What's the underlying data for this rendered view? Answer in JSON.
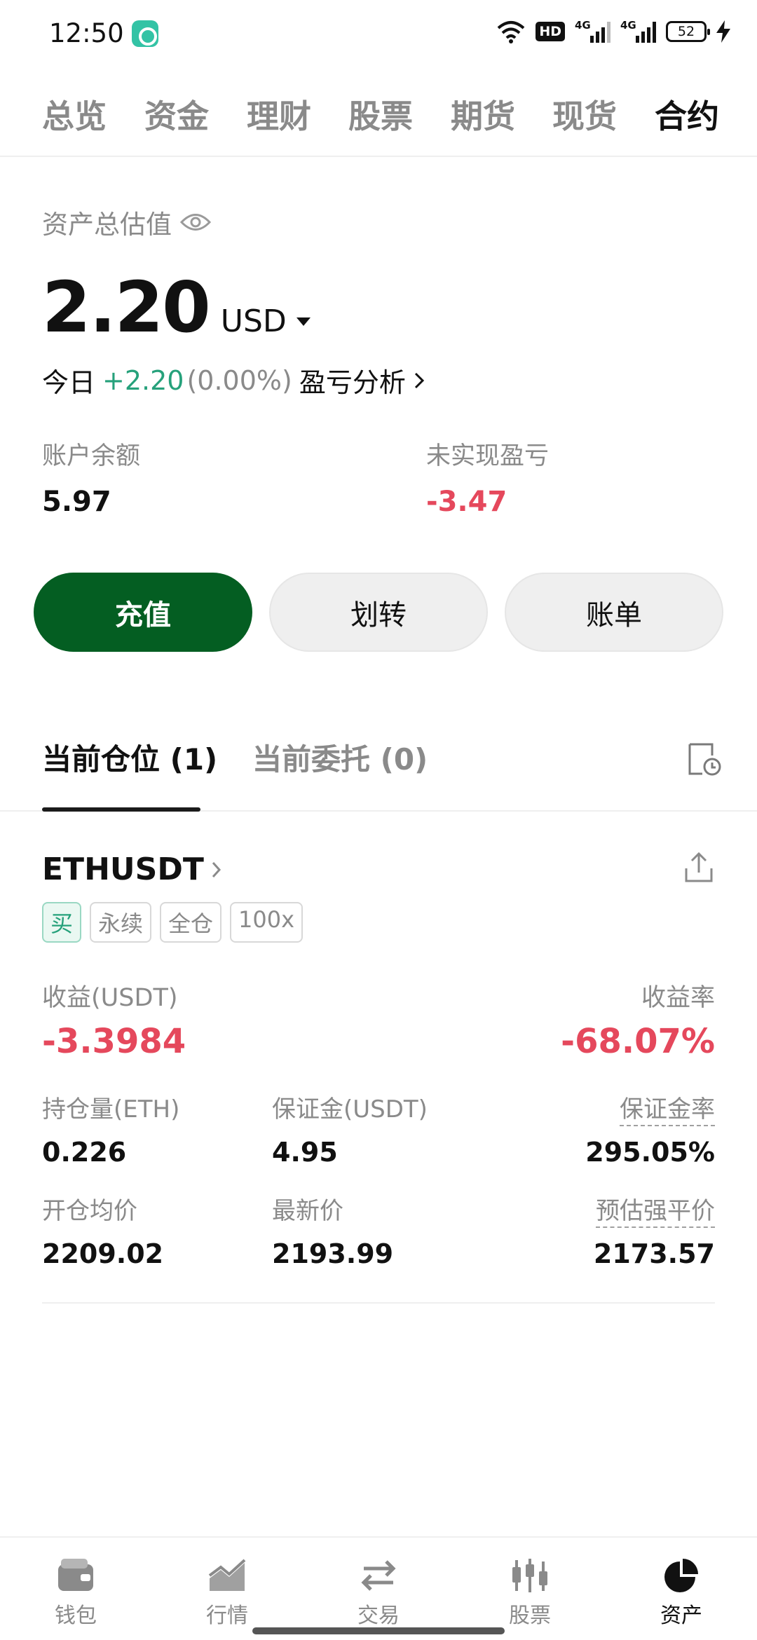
{
  "status_bar": {
    "time": "12:50",
    "hd": "HD",
    "net1": "4G",
    "net2": "4G",
    "battery": "52"
  },
  "top_tabs": [
    "总览",
    "资金",
    "理财",
    "股票",
    "期货",
    "现货",
    "合约"
  ],
  "top_tab_active": "合约",
  "asset": {
    "label": "资产总估值",
    "total": "2.20",
    "currency": "USD",
    "today_label": "今日",
    "today_change": "+2.20",
    "today_pct": "(0.00%)",
    "analysis_link": "盈亏分析",
    "balance_label": "账户余额",
    "balance_value": "5.97",
    "unrealized_label": "未实现盈亏",
    "unrealized_value": "-3.47"
  },
  "actions": {
    "deposit": "充值",
    "transfer": "划转",
    "bill": "账单"
  },
  "position_tabs": {
    "current": "当前仓位 (1)",
    "orders": "当前委托 (0)"
  },
  "position": {
    "symbol": "ETHUSDT",
    "tags": [
      "买",
      "永续",
      "全仓",
      "100x"
    ],
    "pnl_label": "收益(USDT)",
    "pnl_value": "-3.3984",
    "roe_label": "收益率",
    "roe_value": "-68.07%",
    "size_label": "持仓量(ETH)",
    "size_value": "0.226",
    "margin_label": "保证金(USDT)",
    "margin_value": "4.95",
    "margin_ratio_label": "保证金率",
    "margin_ratio_value": "295.05%",
    "entry_label": "开仓均价",
    "entry_value": "2209.02",
    "last_label": "最新价",
    "last_value": "2193.99",
    "liq_label": "预估强平价",
    "liq_value": "2173.57"
  },
  "bottom_nav": {
    "wallet": "钱包",
    "market": "行情",
    "trade": "交易",
    "stocks": "股票",
    "assets": "资产"
  },
  "colors": {
    "primary_green": "#045e22",
    "gain_green": "#26a17b",
    "loss_red": "#e5485c"
  }
}
